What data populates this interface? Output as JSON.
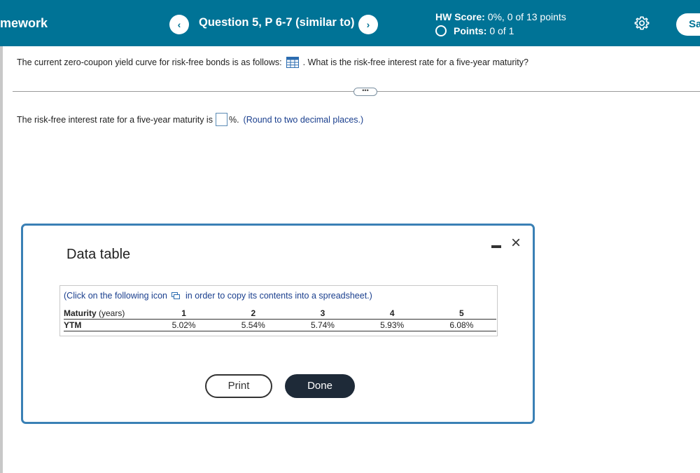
{
  "header": {
    "app_title": "mework",
    "question_title": "Question 5, P 6-7 (similar to)",
    "prev_symbol": "‹",
    "next_symbol": "›",
    "hw_score_label": "HW Score:",
    "hw_score_value": "0%, 0 of 13 points",
    "points_label": "Points:",
    "points_value": "0 of 1",
    "save_label": "Sa"
  },
  "question": {
    "prompt_before": "The current zero-coupon yield curve for risk-free bonds is as follows:",
    "prompt_after": ". What is the risk-free interest rate for a five-year maturity?",
    "more_label": "•••",
    "answer_before": "The risk-free interest rate for a five-year maturity is",
    "answer_value": "",
    "answer_after": "%.",
    "round_note": "(Round to two decimal places.)"
  },
  "modal": {
    "title": "Data table",
    "click_note_before": "(Click on the following icon",
    "click_note_after": "in order to copy its contents into a spreadsheet.)",
    "row_header_maturity": "Maturity",
    "row_header_maturity_unit": "(years)",
    "row_header_ytm": "YTM",
    "maturities": [
      "1",
      "2",
      "3",
      "4",
      "5"
    ],
    "ytm": [
      "5.02%",
      "5.54%",
      "5.74%",
      "5.93%",
      "6.08%"
    ],
    "print_label": "Print",
    "done_label": "Done",
    "close_symbol": "×"
  },
  "colors": {
    "header_bg": "#007396",
    "done_bg": "#1e2a38",
    "modal_border": "#3a80b5",
    "link_text": "#1a3f8e"
  }
}
